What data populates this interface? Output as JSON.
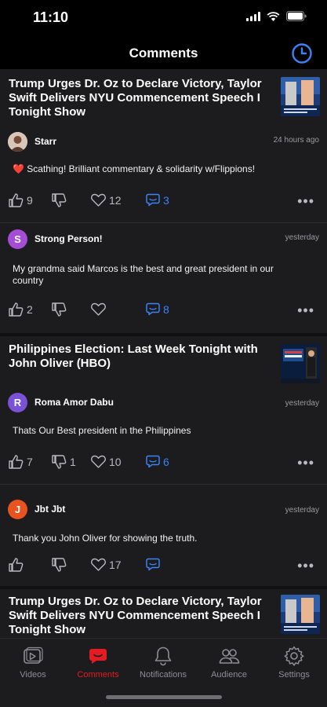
{
  "status": {
    "time": "11:10"
  },
  "nav": {
    "title": "Comments"
  },
  "colors": {
    "accent_blue": "#3b82f6",
    "active_red": "#e31b23",
    "background": "#1c1c1e"
  },
  "feed": {
    "blocks": [
      {
        "video_title": "Trump Urges Dr. Oz to Declare Victory, Taylor Swift Delivers NYU Commencement Speech I Tonight Show",
        "comments": [
          {
            "avatar_letter": "",
            "author": "Starr",
            "time": "24 hours ago",
            "text": "❤️ Scathing! Brilliant commentary & solidarity w/Flippions!",
            "likes": "9",
            "dislikes": "",
            "hearts": "12",
            "replies": "3"
          },
          {
            "avatar_letter": "S",
            "author": "Strong Person!",
            "time": "yesterday",
            "text": "My grandma said Marcos is the best and great president in our country",
            "likes": "2",
            "dislikes": "",
            "hearts": "",
            "replies": "8"
          }
        ]
      },
      {
        "video_title": "Philippines Election: Last Week Tonight with John Oliver (HBO)",
        "comments": [
          {
            "avatar_letter": "R",
            "author": "Roma Amor Dabu",
            "time": "yesterday",
            "text": "Thats Our Best president in the Philippines",
            "likes": "7",
            "dislikes": "1",
            "hearts": "10",
            "replies": "6"
          },
          {
            "avatar_letter": "J",
            "author": "Jbt Jbt",
            "time": "yesterday",
            "text": "Thank you John Oliver for showing the truth.",
            "likes": "",
            "dislikes": "",
            "hearts": "17",
            "replies": ""
          }
        ]
      },
      {
        "video_title": "Trump Urges Dr. Oz to Declare Victory, Taylor Swift Delivers NYU Commencement Speech I Tonight Show"
      }
    ]
  },
  "tabs": [
    {
      "label": "Videos",
      "icon": "play-icon"
    },
    {
      "label": "Comments",
      "icon": "comments-icon",
      "active": true
    },
    {
      "label": "Notifications",
      "icon": "bell-icon"
    },
    {
      "label": "Audience",
      "icon": "people-icon"
    },
    {
      "label": "Settings",
      "icon": "gear-icon"
    }
  ]
}
